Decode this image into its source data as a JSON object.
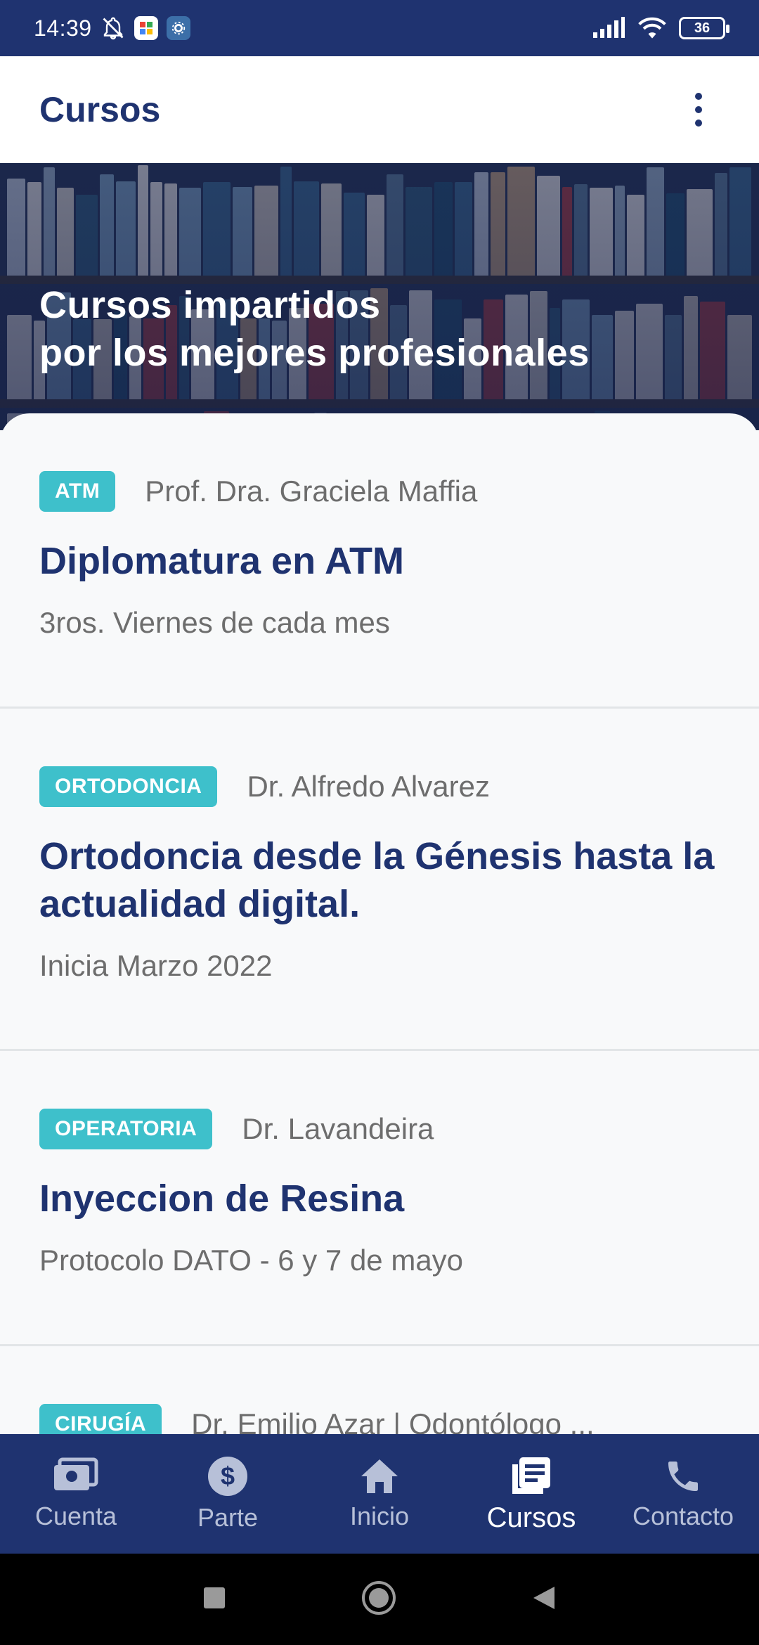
{
  "status_bar": {
    "time": "14:39",
    "battery_level": "36",
    "icons": [
      "bell-off-icon",
      "app-icon",
      "gear-icon",
      "signal-icon",
      "wifi-icon",
      "battery-icon"
    ]
  },
  "app_bar": {
    "title": "Cursos",
    "menu_icon": "more-vert-icon"
  },
  "hero": {
    "line1": "Cursos impartidos",
    "line2": "por los mejores profesionales"
  },
  "courses": [
    {
      "tag": "ATM",
      "teacher": "Prof. Dra. Graciela Maffia",
      "title": "Diplomatura en ATM",
      "subtitle": "3ros. Viernes de cada mes"
    },
    {
      "tag": "ORTODONCIA",
      "teacher": "Dr. Alfredo Alvarez",
      "title": "Ortodoncia desde la Génesis hasta la actualidad digital.",
      "subtitle": "Inicia Marzo 2022"
    },
    {
      "tag": "OPERATORIA",
      "teacher": "Dr. Lavandeira",
      "title": "Inyeccion de Resina",
      "subtitle": "Protocolo DATO - 6 y 7  de mayo"
    },
    {
      "tag": "CIRUGÍA",
      "teacher": "Dr. Emilio Azar | Odontólogo ..."
    }
  ],
  "bottom_nav": {
    "active": "Cursos",
    "items": [
      {
        "label": "Cuenta",
        "icon": "account-card-icon"
      },
      {
        "label": "Parte",
        "icon": "dollar-icon"
      },
      {
        "label": "Inicio",
        "icon": "home-icon"
      },
      {
        "label": "Cursos",
        "icon": "courses-icon"
      },
      {
        "label": "Contacto",
        "icon": "phone-icon"
      }
    ]
  },
  "colors": {
    "primary": "#1f3370",
    "accent": "#3ec0cb",
    "text_muted": "#6d6d6d"
  }
}
